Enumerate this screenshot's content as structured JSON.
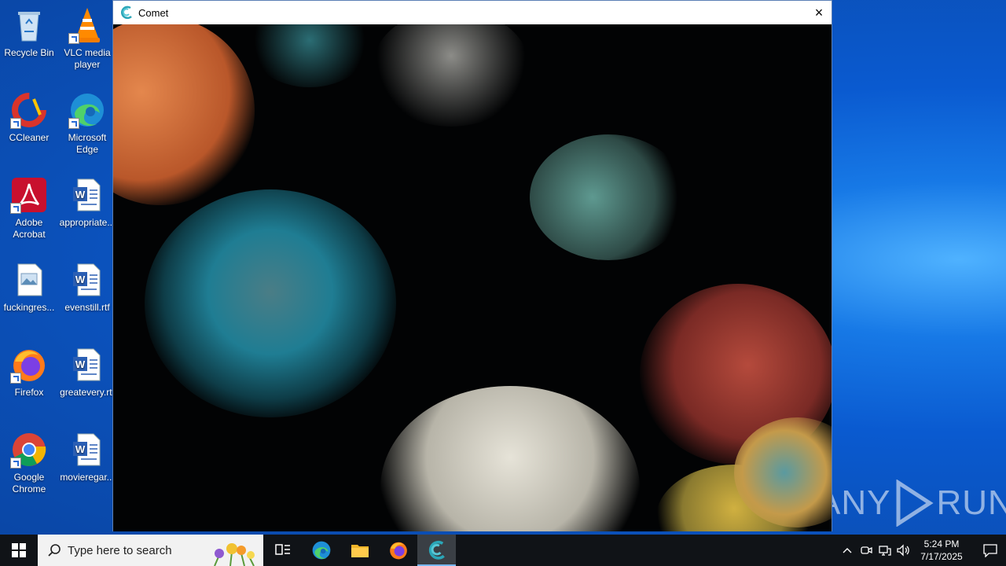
{
  "desktop": {
    "icons": [
      {
        "label": "Recycle Bin"
      },
      {
        "label": "VLC media player"
      },
      {
        "label": "CCleaner"
      },
      {
        "label": "Microsoft Edge"
      },
      {
        "label": "Adobe Acrobat"
      },
      {
        "label": "appropriate..."
      },
      {
        "label": "fuckingres..."
      },
      {
        "label": "evenstill.rtf"
      },
      {
        "label": "Firefox"
      },
      {
        "label": "greatevery.rtf"
      },
      {
        "label": "Google Chrome"
      },
      {
        "label": "movieregar..."
      }
    ]
  },
  "window": {
    "title": "Comet",
    "close_icon": "×"
  },
  "taskbar": {
    "search_placeholder": "Type here to search",
    "clock_time": "5:24 PM",
    "clock_date": "7/17/2025"
  },
  "watermark": {
    "text_left": "ANY",
    "text_right": "RUN"
  },
  "colors": {
    "accent": "#0a5ad0",
    "taskbar": "#101317"
  }
}
